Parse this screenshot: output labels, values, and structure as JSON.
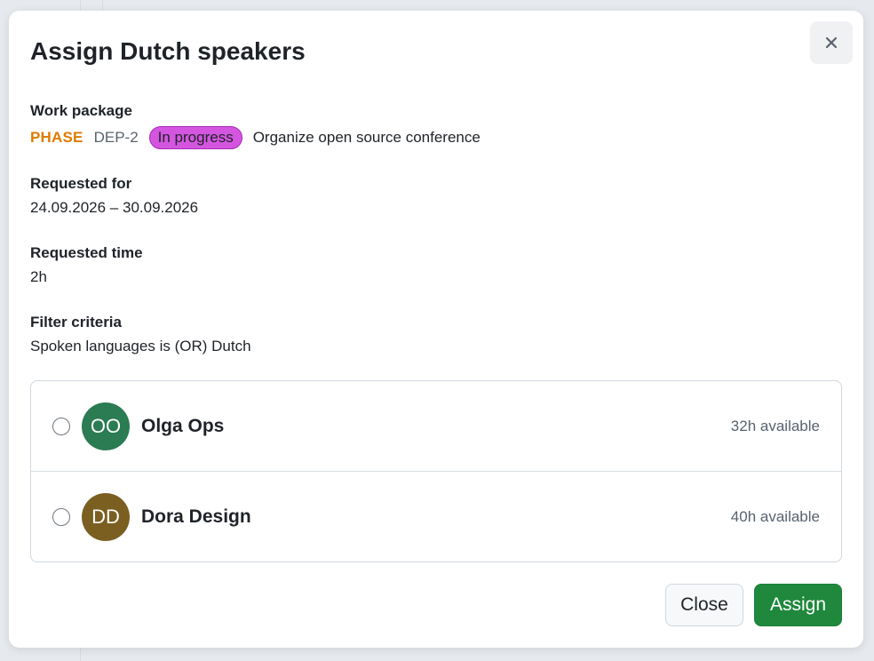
{
  "dialog": {
    "title": "Assign Dutch speakers"
  },
  "work_package": {
    "label": "Work package",
    "type": "PHASE",
    "id": "DEP-2",
    "status": "In progress",
    "subject": "Organize open source conference",
    "type_color": "#e07a00",
    "status_color": "#d456e0"
  },
  "requested_for": {
    "label": "Requested for",
    "value": "24.09.2026 – 30.09.2026"
  },
  "requested_time": {
    "label": "Requested time",
    "value": "2h"
  },
  "filter_criteria": {
    "label": "Filter criteria",
    "value": "Spoken languages is (OR) Dutch"
  },
  "users": [
    {
      "initials": "OO",
      "name": "Olga Ops",
      "availability": "32h available",
      "avatar_color": "#2b7b53",
      "selected": false
    },
    {
      "initials": "DD",
      "name": "Dora Design",
      "availability": "40h available",
      "avatar_color": "#7a5f21",
      "selected": false
    }
  ],
  "footer": {
    "close_label": "Close",
    "assign_label": "Assign"
  },
  "icons": {
    "close": "close-icon"
  }
}
